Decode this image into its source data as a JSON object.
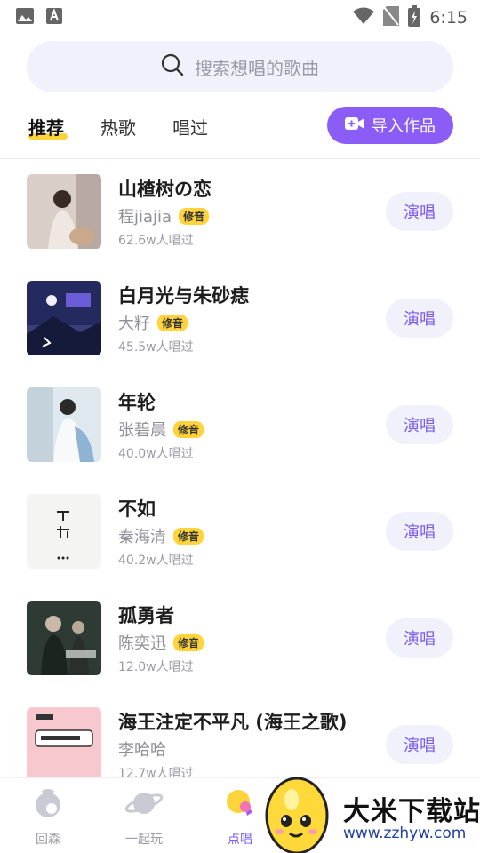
{
  "status_bar": {
    "time": "6:15"
  },
  "search": {
    "placeholder": "搜索想唱的歌曲"
  },
  "tabs": [
    {
      "label": "推荐",
      "active": true
    },
    {
      "label": "热歌",
      "active": false
    },
    {
      "label": "唱过",
      "active": false
    }
  ],
  "import_button": {
    "label": "导入作品"
  },
  "songs": [
    {
      "title": "山楂树の恋",
      "artist": "程jiajia",
      "badge": "修音",
      "count": "62.6w人唱过",
      "action": "演唱"
    },
    {
      "title": "白月光与朱砂痣",
      "artist": "大籽",
      "badge": "修音",
      "count": "45.5w人唱过",
      "action": "演唱"
    },
    {
      "title": "年轮",
      "artist": "张碧晨",
      "badge": "修音",
      "count": "40.0w人唱过",
      "action": "演唱"
    },
    {
      "title": "不如",
      "artist": "秦海清",
      "badge": "修音",
      "count": "40.2w人唱过",
      "action": "演唱"
    },
    {
      "title": "孤勇者",
      "artist": "陈奕迅",
      "badge": "修音",
      "count": "12.0w人唱过",
      "action": "演唱"
    },
    {
      "title": "海王注定不平凡 (海王之歌)",
      "artist": "李哈哈",
      "badge": "",
      "count": "12.7w人唱过",
      "action": "演唱"
    }
  ],
  "bottom_nav": [
    {
      "label": "回森",
      "active": false
    },
    {
      "label": "一起玩",
      "active": false
    },
    {
      "label": "点唱",
      "active": true
    }
  ],
  "watermark": {
    "title": "大米下载站",
    "url": "www.zzhyw.com"
  },
  "colors": {
    "accent": "#8b5cf6",
    "badge": "#ffd43b",
    "sing_text": "#7c5cf0"
  }
}
